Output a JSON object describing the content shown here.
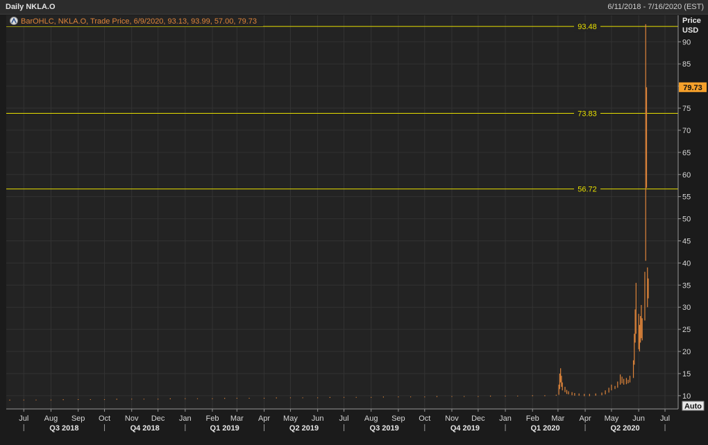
{
  "header": {
    "title": "Daily NKLA.O",
    "date_range": "6/11/2018 - 7/16/2020 (EST)"
  },
  "legend": {
    "text": "BarOHLC, NKLA.O, Trade Price, 6/9/2020, 93.13, 93.99, 57.00, 79.73",
    "icon": "chart-settings-icon"
  },
  "axis": {
    "price_label": "Price",
    "currency_label": "USD",
    "auto_button": "Auto"
  },
  "colors": {
    "background": "#232323",
    "bar": "#e0853a",
    "hline": "#e8e000",
    "last_price_bg": "#f5a02b",
    "grid": "#333333"
  },
  "chart_data": {
    "type": "bar",
    "subtype": "ohlc",
    "title": "Daily NKLA.O",
    "ylabel": "Price USD",
    "ylim": [
      7,
      96
    ],
    "y_ticks": [
      10,
      15,
      20,
      25,
      30,
      35,
      40,
      45,
      50,
      55,
      60,
      65,
      70,
      75,
      80,
      85,
      90
    ],
    "last_price": "79.73",
    "horizontal_lines": [
      {
        "value": 93.48,
        "label": "93.48"
      },
      {
        "value": 73.83,
        "label": "73.83"
      },
      {
        "value": 56.72,
        "label": "56.72"
      }
    ],
    "x_start": "2018-06-11",
    "x_end": "2020-07-16",
    "x_ticks": [
      {
        "date": "2018-07-01",
        "label": "Jul"
      },
      {
        "date": "2018-08-01",
        "label": "Aug"
      },
      {
        "date": "2018-09-01",
        "label": "Sep"
      },
      {
        "date": "2018-10-01",
        "label": "Oct"
      },
      {
        "date": "2018-11-01",
        "label": "Nov"
      },
      {
        "date": "2018-12-01",
        "label": "Dec"
      },
      {
        "date": "2019-01-01",
        "label": "Jan"
      },
      {
        "date": "2019-02-01",
        "label": "Feb"
      },
      {
        "date": "2019-03-01",
        "label": "Mar"
      },
      {
        "date": "2019-04-01",
        "label": "Apr"
      },
      {
        "date": "2019-05-01",
        "label": "May"
      },
      {
        "date": "2019-06-01",
        "label": "Jun"
      },
      {
        "date": "2019-07-01",
        "label": "Jul"
      },
      {
        "date": "2019-08-01",
        "label": "Aug"
      },
      {
        "date": "2019-09-01",
        "label": "Sep"
      },
      {
        "date": "2019-10-01",
        "label": "Oct"
      },
      {
        "date": "2019-11-01",
        "label": "Nov"
      },
      {
        "date": "2019-12-01",
        "label": "Dec"
      },
      {
        "date": "2020-01-01",
        "label": "Jan"
      },
      {
        "date": "2020-02-01",
        "label": "Feb"
      },
      {
        "date": "2020-03-01",
        "label": "Mar"
      },
      {
        "date": "2020-04-01",
        "label": "Apr"
      },
      {
        "date": "2020-05-01",
        "label": "May"
      },
      {
        "date": "2020-06-01",
        "label": "Jun"
      },
      {
        "date": "2020-07-01",
        "label": "Jul"
      }
    ],
    "quarters": [
      {
        "label": "Q3 2018",
        "start": "2018-07-01",
        "end": "2018-10-01"
      },
      {
        "label": "Q4 2018",
        "start": "2018-10-01",
        "end": "2019-01-01"
      },
      {
        "label": "Q1 2019",
        "start": "2019-01-01",
        "end": "2019-04-01"
      },
      {
        "label": "Q2 2019",
        "start": "2019-04-01",
        "end": "2019-07-01"
      },
      {
        "label": "Q3 2019",
        "start": "2019-07-01",
        "end": "2019-10-01"
      },
      {
        "label": "Q4 2019",
        "start": "2019-10-01",
        "end": "2020-01-01"
      },
      {
        "label": "Q1 2020",
        "start": "2020-01-01",
        "end": "2020-04-01"
      },
      {
        "label": "Q2 2020",
        "start": "2020-04-01",
        "end": "2020-07-01"
      }
    ],
    "series": [
      {
        "values": [
          {
            "date": "2018-06-15",
            "high": 9.1,
            "low": 8.9
          },
          {
            "date": "2018-07-01",
            "high": 9.1,
            "low": 9.0
          },
          {
            "date": "2018-07-15",
            "high": 9.1,
            "low": 9.0
          },
          {
            "date": "2018-08-01",
            "high": 9.1,
            "low": 9.0
          },
          {
            "date": "2018-08-15",
            "high": 9.2,
            "low": 9.0
          },
          {
            "date": "2018-09-01",
            "high": 9.2,
            "low": 9.1
          },
          {
            "date": "2018-09-15",
            "high": 9.2,
            "low": 9.1
          },
          {
            "date": "2018-10-01",
            "high": 9.2,
            "low": 9.1
          },
          {
            "date": "2018-10-15",
            "high": 9.3,
            "low": 9.1
          },
          {
            "date": "2018-11-01",
            "high": 9.3,
            "low": 9.2
          },
          {
            "date": "2018-11-15",
            "high": 9.3,
            "low": 9.2
          },
          {
            "date": "2018-12-01",
            "high": 9.3,
            "low": 9.2
          },
          {
            "date": "2018-12-15",
            "high": 9.4,
            "low": 9.2
          },
          {
            "date": "2019-01-01",
            "high": 9.4,
            "low": 9.3
          },
          {
            "date": "2019-01-15",
            "high": 9.4,
            "low": 9.3
          },
          {
            "date": "2019-02-01",
            "high": 9.4,
            "low": 9.3
          },
          {
            "date": "2019-02-15",
            "high": 9.5,
            "low": 9.3
          },
          {
            "date": "2019-03-01",
            "high": 9.5,
            "low": 9.4
          },
          {
            "date": "2019-03-15",
            "high": 9.5,
            "low": 9.4
          },
          {
            "date": "2019-04-01",
            "high": 9.5,
            "low": 9.4
          },
          {
            "date": "2019-04-15",
            "high": 9.6,
            "low": 9.4
          },
          {
            "date": "2019-05-01",
            "high": 9.6,
            "low": 9.5
          },
          {
            "date": "2019-05-15",
            "high": 9.6,
            "low": 9.5
          },
          {
            "date": "2019-06-01",
            "high": 9.6,
            "low": 9.5
          },
          {
            "date": "2019-06-15",
            "high": 9.7,
            "low": 9.5
          },
          {
            "date": "2019-07-01",
            "high": 9.7,
            "low": 9.6
          },
          {
            "date": "2019-07-15",
            "high": 9.7,
            "low": 9.6
          },
          {
            "date": "2019-08-01",
            "high": 9.7,
            "low": 9.6
          },
          {
            "date": "2019-08-15",
            "high": 9.8,
            "low": 9.6
          },
          {
            "date": "2019-09-01",
            "high": 9.8,
            "low": 9.7
          },
          {
            "date": "2019-09-15",
            "high": 9.8,
            "low": 9.7
          },
          {
            "date": "2019-10-01",
            "high": 9.8,
            "low": 9.7
          },
          {
            "date": "2019-10-15",
            "high": 9.9,
            "low": 9.7
          },
          {
            "date": "2019-11-01",
            "high": 9.9,
            "low": 9.8
          },
          {
            "date": "2019-11-15",
            "high": 9.9,
            "low": 9.8
          },
          {
            "date": "2019-12-01",
            "high": 9.9,
            "low": 9.8
          },
          {
            "date": "2019-12-15",
            "high": 10.0,
            "low": 9.8
          },
          {
            "date": "2020-01-01",
            "high": 10.0,
            "low": 9.9
          },
          {
            "date": "2020-01-15",
            "high": 10.0,
            "low": 9.9
          },
          {
            "date": "2020-02-01",
            "high": 10.1,
            "low": 9.9
          },
          {
            "date": "2020-02-15",
            "high": 10.1,
            "low": 9.9
          },
          {
            "date": "2020-02-28",
            "high": 10.2,
            "low": 10.0
          },
          {
            "date": "2020-03-02",
            "high": 12.5,
            "low": 10.2
          },
          {
            "date": "2020-03-03",
            "high": 15.0,
            "low": 11.5
          },
          {
            "date": "2020-03-04",
            "high": 16.2,
            "low": 13.0
          },
          {
            "date": "2020-03-05",
            "high": 14.5,
            "low": 12.0
          },
          {
            "date": "2020-03-06",
            "high": 13.0,
            "low": 11.2
          },
          {
            "date": "2020-03-09",
            "high": 12.0,
            "low": 10.8
          },
          {
            "date": "2020-03-11",
            "high": 11.3,
            "low": 10.4
          },
          {
            "date": "2020-03-13",
            "high": 11.0,
            "low": 10.3
          },
          {
            "date": "2020-03-17",
            "high": 10.8,
            "low": 10.1
          },
          {
            "date": "2020-03-20",
            "high": 10.6,
            "low": 10.0
          },
          {
            "date": "2020-03-25",
            "high": 10.5,
            "low": 10.0
          },
          {
            "date": "2020-03-31",
            "high": 10.4,
            "low": 9.9
          },
          {
            "date": "2020-04-06",
            "high": 10.4,
            "low": 9.9
          },
          {
            "date": "2020-04-13",
            "high": 10.5,
            "low": 10.0
          },
          {
            "date": "2020-04-20",
            "high": 10.7,
            "low": 10.1
          },
          {
            "date": "2020-04-24",
            "high": 11.2,
            "low": 10.3
          },
          {
            "date": "2020-04-28",
            "high": 11.8,
            "low": 10.7
          },
          {
            "date": "2020-05-01",
            "high": 12.5,
            "low": 11.2
          },
          {
            "date": "2020-05-05",
            "high": 12.2,
            "low": 11.5
          },
          {
            "date": "2020-05-08",
            "high": 13.2,
            "low": 11.8
          },
          {
            "date": "2020-05-11",
            "high": 14.8,
            "low": 12.5
          },
          {
            "date": "2020-05-13",
            "high": 14.3,
            "low": 12.8
          },
          {
            "date": "2020-05-15",
            "high": 13.8,
            "low": 12.5
          },
          {
            "date": "2020-05-18",
            "high": 14.0,
            "low": 12.6
          },
          {
            "date": "2020-05-20",
            "high": 13.6,
            "low": 12.8
          },
          {
            "date": "2020-05-22",
            "high": 14.5,
            "low": 13.0
          },
          {
            "date": "2020-05-26",
            "high": 18.0,
            "low": 14.0
          },
          {
            "date": "2020-05-27",
            "high": 24.0,
            "low": 17.0
          },
          {
            "date": "2020-05-28",
            "high": 29.5,
            "low": 22.0
          },
          {
            "date": "2020-05-29",
            "high": 35.5,
            "low": 24.0
          },
          {
            "date": "2020-06-01",
            "high": 28.5,
            "low": 20.5
          },
          {
            "date": "2020-06-02",
            "high": 26.0,
            "low": 20.0
          },
          {
            "date": "2020-06-03",
            "high": 28.0,
            "low": 22.0
          },
          {
            "date": "2020-06-04",
            "high": 30.5,
            "low": 23.0
          },
          {
            "date": "2020-06-05",
            "high": 27.5,
            "low": 22.5
          },
          {
            "date": "2020-06-08",
            "high": 38.0,
            "low": 27.0
          },
          {
            "date": "2020-06-09",
            "high": 93.99,
            "low": 40.5
          },
          {
            "date": "2020-06-10",
            "high": 79.73,
            "low": 57.0
          },
          {
            "date": "2020-06-11",
            "high": 39.0,
            "low": 30.0
          },
          {
            "date": "2020-06-12",
            "high": 36.5,
            "low": 32.0
          }
        ]
      }
    ]
  }
}
